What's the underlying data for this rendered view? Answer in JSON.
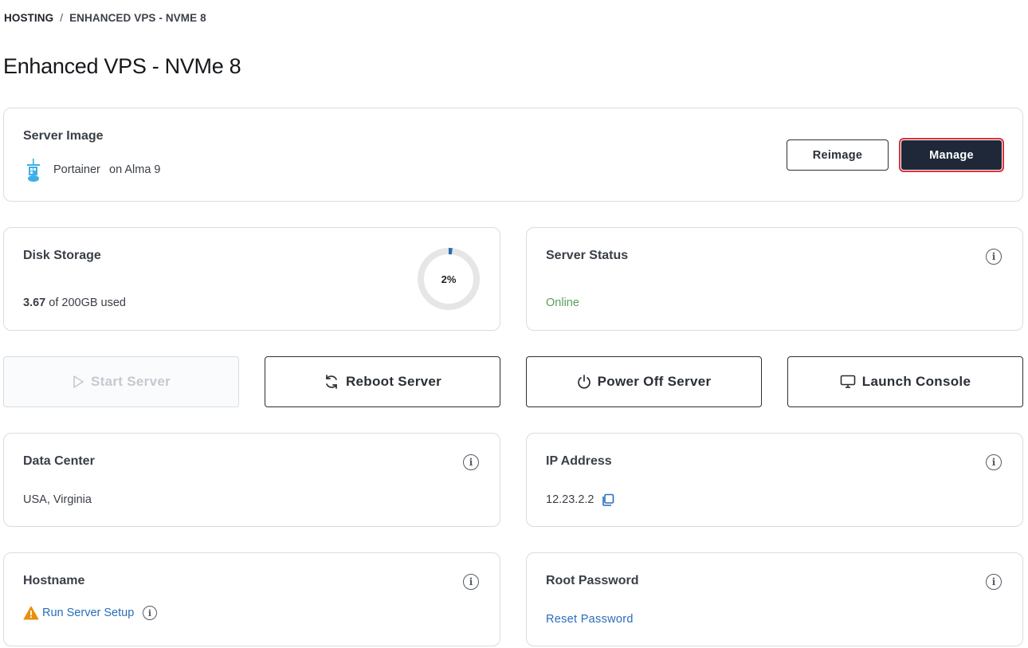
{
  "breadcrumb": {
    "root": "HOSTING",
    "separator": "/",
    "current": "ENHANCED VPS - NVME 8"
  },
  "page_title": "Enhanced VPS - NVMe 8",
  "server_image": {
    "title": "Server Image",
    "app_name": "Portainer",
    "os": "on Alma 9",
    "reimage_label": "Reimage",
    "manage_label": "Manage"
  },
  "disk_storage": {
    "title": "Disk Storage",
    "used": "3.67",
    "of_text": "of 200GB used",
    "percent_label": "2%",
    "percent_value": 2,
    "ring_color": "#e6e6e6",
    "fill_color": "#2a6cb8"
  },
  "server_status": {
    "title": "Server Status",
    "status": "Online",
    "status_color": "#5aa05a"
  },
  "actions": {
    "start_label": "Start Server",
    "reboot_label": "Reboot Server",
    "power_off_label": "Power Off Server",
    "console_label": "Launch Console"
  },
  "data_center": {
    "title": "Data Center",
    "value": "USA, Virginia"
  },
  "ip_address": {
    "title": "IP Address",
    "value": "12.23.2.2"
  },
  "hostname": {
    "title": "Hostname",
    "setup_link": "Run Server Setup"
  },
  "root_password": {
    "title": "Root Password",
    "reset_link": "Reset Password"
  },
  "colors": {
    "accent": "#2a6cb8",
    "dark_button": "#1f2838",
    "warning": "#e8900c",
    "highlight": "#d9343b"
  }
}
